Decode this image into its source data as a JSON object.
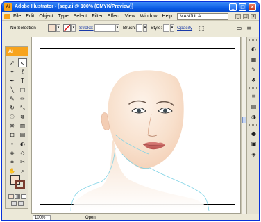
{
  "window": {
    "app_icon_label": "Ai",
    "title": "Adobe Illustrator - [seg.ai @ 100% (CMYK/Preview)]",
    "buttons": [
      "_",
      "□",
      "×"
    ]
  },
  "menubar": {
    "items": [
      "File",
      "Edit",
      "Object",
      "Type",
      "Select",
      "Filter",
      "Effect",
      "View",
      "Window",
      "Help"
    ],
    "username": "MANJULA",
    "doc_buttons": [
      "_",
      "□",
      "×"
    ]
  },
  "controlbar": {
    "selection_label": "No Selection",
    "stroke_label": "Stroke:",
    "brush_label": "Brush:",
    "style_label": "Style:",
    "opacity_label": "Opacity"
  },
  "toolbox": {
    "logo": "Ai",
    "tools": [
      "selection-icon",
      "direct-selection-icon",
      "magic-wand-icon",
      "lasso-icon",
      "pen-icon",
      "type-icon",
      "line-icon",
      "rectangle-icon",
      "paintbrush-icon",
      "pencil-icon",
      "rotate-icon",
      "scale-icon",
      "warp-icon",
      "free-transform-icon",
      "symbol-sprayer-icon",
      "graph-icon",
      "mesh-icon",
      "gradient-icon",
      "eyedropper-icon",
      "blend-icon",
      "live-paint-icon",
      "live-paint-select-icon",
      "slice-icon",
      "scissors-icon",
      "hand-icon",
      "zoom-icon"
    ]
  },
  "status": {
    "zoom": "100%",
    "text": "Open"
  },
  "colors": {
    "titlebar": "#0a5ae4",
    "chrome": "#ece9d8",
    "skin": "#f8e4d2",
    "contour": "#7fd3e6",
    "lips": "#c96a66",
    "fill_swatch": "#f5e0ce",
    "stroke_swatch": "#7a3b2e"
  },
  "panels": [
    "color-panel-icon",
    "swatches-icon",
    "brushes-icon",
    "symbols-icon",
    "stroke-panel-icon",
    "gradient-panel-icon",
    "transparency-icon",
    "appearance-icon",
    "graphic-styles-icon",
    "layers-icon"
  ]
}
